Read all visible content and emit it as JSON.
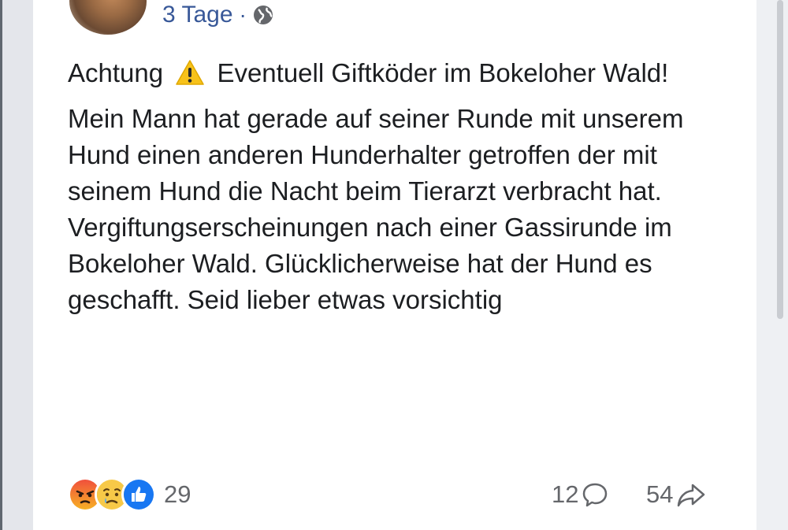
{
  "post": {
    "time": "3 Tage",
    "separator": "·",
    "privacy_icon": "globe-icon",
    "line_title_before": "Achtung",
    "warning_icon": "warning-icon",
    "line_title_after": "Eventuell Giftköder im Bokeloher Wald!",
    "body": "Mein Mann hat gerade auf seiner Runde mit unserem Hund einen anderen Hunderhalter getroffen der mit seinem Hund die Nacht beim Tierarzt verbracht hat. Vergiftungserscheinungen nach einer Gassirunde im Bokeloher Wald. Glücklicherweise hat der Hund es geschafft. Seid lieber etwas vorsichtig"
  },
  "footer": {
    "reactions": [
      "angry-reaction-icon",
      "sad-reaction-icon",
      "like-reaction-icon"
    ],
    "reaction_count": "29",
    "comment_count": "12",
    "share_count": "54"
  },
  "colors": {
    "link_blue": "#385898",
    "text": "#1c1e21",
    "muted": "#65676b",
    "like_blue": "#1877f2"
  }
}
